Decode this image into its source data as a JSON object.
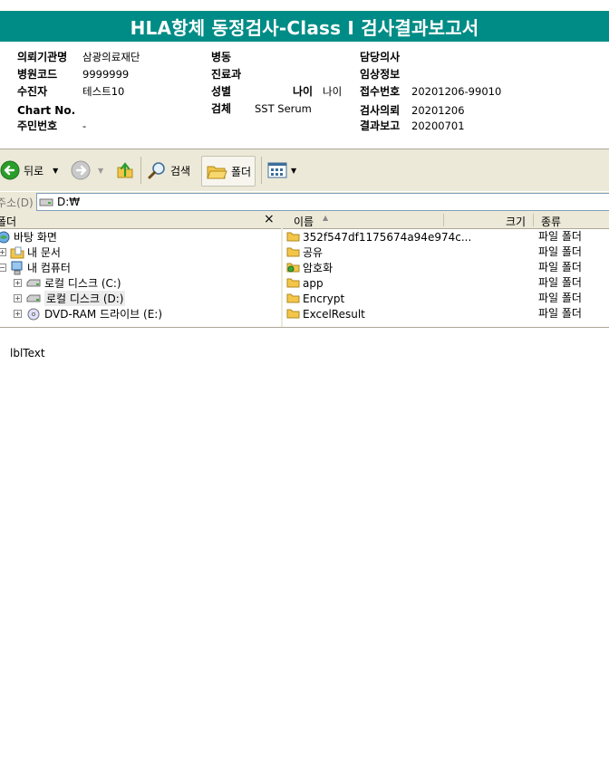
{
  "report": {
    "title": "HLA항체 동정검사-Class I 검사결과보고서"
  },
  "info": {
    "col1": [
      {
        "label": "의뢰기관명",
        "value": "삼광의료재단"
      },
      {
        "label": "병원코드",
        "value": "9999999"
      },
      {
        "label": "수진자",
        "value": "테스트10"
      },
      {
        "label": "Chart No.",
        "value": ""
      },
      {
        "label": "주민번호",
        "value": "-"
      }
    ],
    "col2": [
      {
        "label": "병동",
        "value": ""
      },
      {
        "label": "진료과",
        "value": ""
      },
      {
        "label": "성별",
        "value": ""
      },
      {
        "label": "검체",
        "value": "SST Serum"
      }
    ],
    "age": {
      "label": "나이",
      "value": "나이"
    },
    "col3": [
      {
        "label": "담당의사",
        "value": ""
      },
      {
        "label": "임상정보",
        "value": ""
      },
      {
        "label": "접수번호",
        "value": "20201206-99010"
      },
      {
        "label": "검사의뢰",
        "value": "20201206"
      },
      {
        "label": "결과보고",
        "value": "20200701"
      }
    ]
  },
  "toolbar": {
    "back_label": "뒤로",
    "search_label": "검색",
    "folders_label": "폴더"
  },
  "address": {
    "label": "주소(D)",
    "value": "D:₩"
  },
  "tree": {
    "header": "폴더",
    "close": "×",
    "items": [
      {
        "label": "바탕 화면"
      },
      {
        "label": "내 문서"
      },
      {
        "label": "내 컴퓨터"
      },
      {
        "label": "로컬 디스크 (C:)"
      },
      {
        "label": "로컬 디스크 (D:)"
      },
      {
        "label": "DVD-RAM 드라이브 (E:)"
      }
    ]
  },
  "list": {
    "columns": {
      "name": "이름",
      "size": "크기",
      "type": "종류"
    },
    "rows": [
      {
        "name": "352f547df1175674a94e974c...",
        "type": "파일 폴더"
      },
      {
        "name": "공유",
        "type": "파일 폴더"
      },
      {
        "name": "암호화",
        "type": "파일 폴더"
      },
      {
        "name": "app",
        "type": "파일 폴더"
      },
      {
        "name": "Encrypt",
        "type": "파일 폴더"
      },
      {
        "name": "ExcelResult",
        "type": "파일 폴더"
      }
    ]
  },
  "footer": {
    "lbl_text": "lblText"
  },
  "colors": {
    "title_bg": "#008c86",
    "folder": "#f3c64a"
  }
}
